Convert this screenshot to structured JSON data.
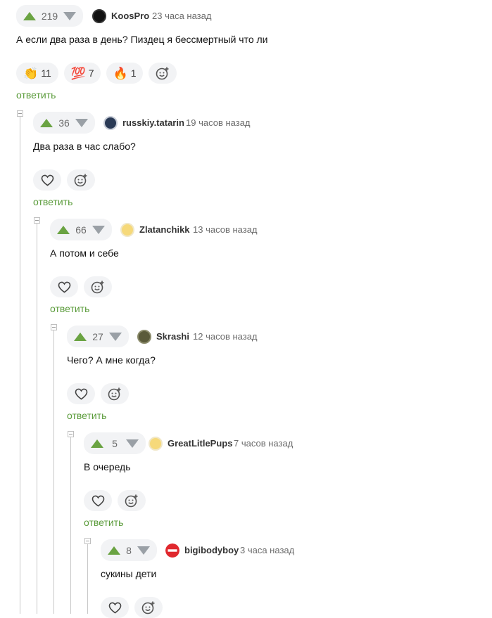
{
  "colors": {
    "upvote": "#6aa342",
    "downvote": "#9aa0a6",
    "reply": "#5a9b3a",
    "pill_bg": "#f2f3f5"
  },
  "comments": [
    {
      "score": "219",
      "username": "KoosPro",
      "time": "23 часа назад",
      "text": "А если два раза в день? Пиздец я бессмертный что ли",
      "reactions": [
        {
          "icon": "clap-icon",
          "emoji": "👏",
          "count": "11"
        },
        {
          "icon": "hundred-icon",
          "emoji": "💯",
          "count": "7"
        },
        {
          "icon": "fire-icon",
          "emoji": "🔥",
          "count": "1"
        }
      ],
      "reply": "ответить"
    },
    {
      "score": "36",
      "username": "russkiy.tatarin",
      "time": "19 часов назад",
      "text": "Два раза в час слабо?",
      "reply": "ответить"
    },
    {
      "score": "66",
      "username": "Zlatanchikk",
      "time": "13 часов назад",
      "text": "А потом и себе",
      "reply": "ответить"
    },
    {
      "score": "27",
      "username": "Skrashi",
      "time": "12 часов назад",
      "text": "Чего? А мне когда?",
      "reply": "ответить"
    },
    {
      "score": "5",
      "username": "GreatLitlePups",
      "time": "7 часов назад",
      "text": "В очередь",
      "reply": "ответить"
    },
    {
      "score": "8",
      "username": "bigibodyboy",
      "time": "3 часа назад",
      "text": "сукины дети"
    }
  ]
}
